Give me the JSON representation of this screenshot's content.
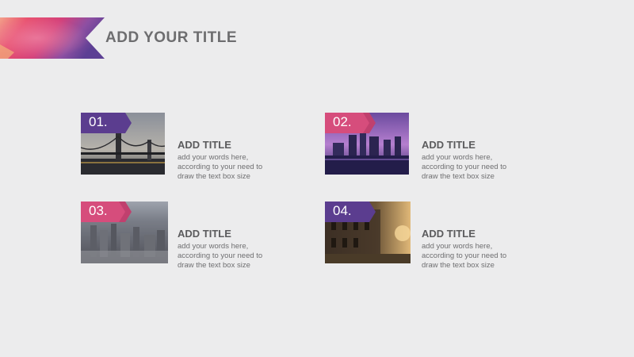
{
  "slide": {
    "title": "ADD YOUR TITLE",
    "colors": {
      "background": "#ececed",
      "purple": "#5b3d8f",
      "pink": "#d64d7c"
    }
  },
  "cards": [
    {
      "number": "01.",
      "title": "ADD TITLE",
      "body": "add your words here,\naccording to your need to\ndraw the text box size",
      "tag_color": "purple",
      "image": "bridge-photo"
    },
    {
      "number": "02.",
      "title": "ADD TITLE",
      "body": "add your words here,\naccording to your need to\ndraw the text box size",
      "tag_color": "pink",
      "image": "skyline-dusk-photo"
    },
    {
      "number": "03.",
      "title": "ADD TITLE",
      "body": "add your words here,\naccording to your need to\ndraw the text box size",
      "tag_color": "pink",
      "image": "city-aerial-photo"
    },
    {
      "number": "04.",
      "title": "ADD TITLE",
      "body": "add your words here,\naccording to your need to\ndraw the text box size",
      "tag_color": "purple",
      "image": "street-sunset-photo"
    }
  ]
}
